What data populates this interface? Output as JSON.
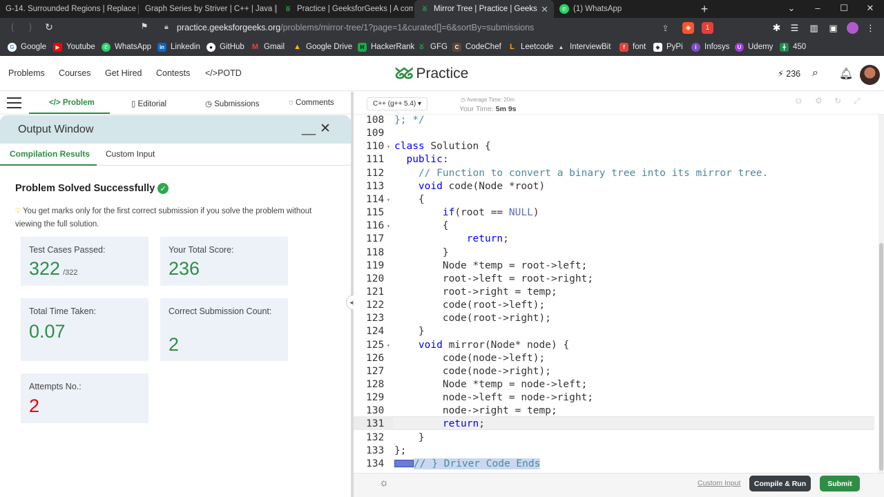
{
  "browser": {
    "tabs": [
      {
        "title": "G-14. Surrounded Regions | Replace O",
        "icon": "youtube-icon"
      },
      {
        "title": "Graph Series by Striver | C++ | Java | In",
        "icon": "youtube-icon"
      },
      {
        "title": "Practice | GeeksforGeeks | A computer",
        "icon": "gfg-icon"
      },
      {
        "title": "Mirror Tree | Practice | GeeksforGe",
        "icon": "gfg-icon",
        "active": true
      },
      {
        "title": "(1) WhatsApp",
        "icon": "whatsapp-icon"
      }
    ],
    "url_host": "practice.geeksforgeeks.org",
    "url_path": "/problems/mirror-tree/1?page=1&curated[]=6&sortBy=submissions",
    "bookmarks": [
      "Google",
      "Youtube",
      "WhatsApp",
      "Linkedin",
      "GitHub",
      "Gmail",
      "Google Drive",
      "HackerRank",
      "GFG",
      "CodeChef",
      "Leetcode",
      "InterviewBit",
      "font",
      "PyPi",
      "Infosys",
      "Udemy",
      "450"
    ],
    "ext_badge": "1"
  },
  "header": {
    "nav": [
      "Problems",
      "Courses",
      "Get Hired",
      "Contests",
      "</>POTD"
    ],
    "logo_text": "Practice",
    "streak": "236"
  },
  "left": {
    "tabs": [
      "Problem",
      "Editorial",
      "Submissions",
      "Comments"
    ],
    "output_title": "Output Window",
    "subtabs": [
      "Compilation Results",
      "Custom Input"
    ],
    "status": "Problem Solved Successfully",
    "note": "You get marks only for the first correct submission if you solve the problem without viewing the full solution.",
    "cards": {
      "tests_label": "Test Cases Passed:",
      "tests_value": "322",
      "tests_total": "/322",
      "score_label": "Your Total Score:",
      "score_value": "236",
      "time_label": "Total Time Taken:",
      "time_value": "0.07",
      "count_label": "Correct Submission Count:",
      "count_value": "2",
      "attempts_label": "Attempts No.:",
      "attempts_value": "2"
    }
  },
  "editor": {
    "language": "C++ (g++ 5.4)",
    "avg_time": "Average Time: 20m",
    "your_time_label": "Your Time:",
    "your_time": "5m 9s",
    "lines": [
      {
        "n": "108",
        "t": "}; */",
        "cls": "c"
      },
      {
        "n": "109",
        "t": ""
      },
      {
        "n": "110",
        "t": "class Solution {",
        "fold": true
      },
      {
        "n": "111",
        "t": "  public:"
      },
      {
        "n": "112",
        "t": "    // Function to convert a binary tree into its mirror tree.",
        "cls": "c"
      },
      {
        "n": "113",
        "t": "    void code(Node *root)"
      },
      {
        "n": "114",
        "t": "    {",
        "fold": true
      },
      {
        "n": "115",
        "t": "        if(root == NULL)"
      },
      {
        "n": "116",
        "t": "        {",
        "fold": true
      },
      {
        "n": "117",
        "t": "            return;"
      },
      {
        "n": "118",
        "t": "        }"
      },
      {
        "n": "119",
        "t": "        Node *temp = root->left;"
      },
      {
        "n": "120",
        "t": "        root->left = root->right;"
      },
      {
        "n": "121",
        "t": "        root->right = temp;"
      },
      {
        "n": "122",
        "t": "        code(root->left);"
      },
      {
        "n": "123",
        "t": "        code(root->right);"
      },
      {
        "n": "124",
        "t": "    }"
      },
      {
        "n": "125",
        "t": "    void mirror(Node* node) {",
        "fold": true
      },
      {
        "n": "126",
        "t": "        code(node->left);"
      },
      {
        "n": "127",
        "t": "        code(node->right);"
      },
      {
        "n": "128",
        "t": "        Node *temp = node->left;"
      },
      {
        "n": "129",
        "t": "        node->left = node->right;"
      },
      {
        "n": "130",
        "t": "        node->right = temp;"
      },
      {
        "n": "131",
        "t": "        return;"
      },
      {
        "n": "132",
        "t": "    }"
      },
      {
        "n": "133",
        "t": "};"
      },
      {
        "n": "134",
        "t": "// } Driver Code Ends",
        "cls": "sel"
      }
    ]
  },
  "footer": {
    "custom_input": "Custom Input",
    "compile_run": "Compile & Run",
    "submit": "Submit"
  }
}
